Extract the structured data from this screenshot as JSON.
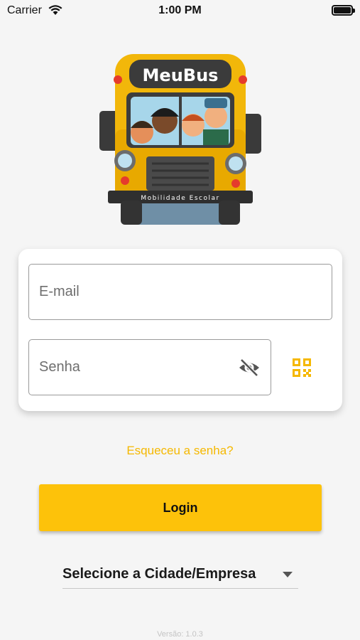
{
  "status_bar": {
    "carrier": "Carrier",
    "time": "1:00 PM",
    "icons": [
      "wifi-icon",
      "battery-icon"
    ]
  },
  "logo": {
    "brand": "MeuBus",
    "tagline": "Mobilidade Escolar"
  },
  "login_form": {
    "email": {
      "placeholder": "E-mail",
      "value": ""
    },
    "password": {
      "placeholder": "Senha",
      "value": "",
      "visibility_icon": "eye-off-icon"
    },
    "qr_icon": "qr-code-icon"
  },
  "forgot_password_label": "Esqueceu a senha?",
  "login_button_label": "Login",
  "city_select": {
    "selected": "Selecione a Cidade/Empresa"
  },
  "version_label": "Versão: 1.0.3",
  "colors": {
    "accent": "#fdc20a",
    "link": "#f5b800",
    "background": "#f5f5f5"
  }
}
